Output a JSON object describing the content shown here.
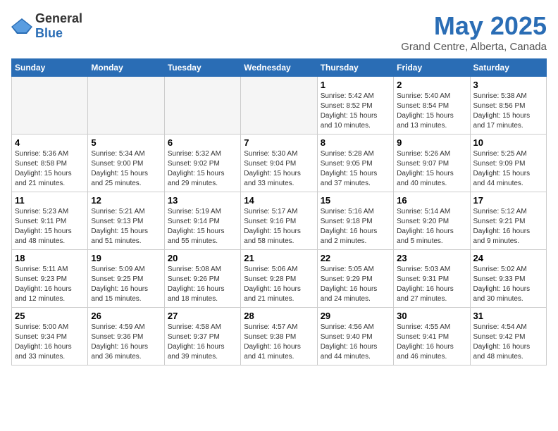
{
  "header": {
    "logo_general": "General",
    "logo_blue": "Blue",
    "title": "May 2025",
    "subtitle": "Grand Centre, Alberta, Canada"
  },
  "days_of_week": [
    "Sunday",
    "Monday",
    "Tuesday",
    "Wednesday",
    "Thursday",
    "Friday",
    "Saturday"
  ],
  "weeks": [
    [
      {
        "num": "",
        "info": ""
      },
      {
        "num": "",
        "info": ""
      },
      {
        "num": "",
        "info": ""
      },
      {
        "num": "",
        "info": ""
      },
      {
        "num": "1",
        "info": "Sunrise: 5:42 AM\nSunset: 8:52 PM\nDaylight: 15 hours\nand 10 minutes."
      },
      {
        "num": "2",
        "info": "Sunrise: 5:40 AM\nSunset: 8:54 PM\nDaylight: 15 hours\nand 13 minutes."
      },
      {
        "num": "3",
        "info": "Sunrise: 5:38 AM\nSunset: 8:56 PM\nDaylight: 15 hours\nand 17 minutes."
      }
    ],
    [
      {
        "num": "4",
        "info": "Sunrise: 5:36 AM\nSunset: 8:58 PM\nDaylight: 15 hours\nand 21 minutes."
      },
      {
        "num": "5",
        "info": "Sunrise: 5:34 AM\nSunset: 9:00 PM\nDaylight: 15 hours\nand 25 minutes."
      },
      {
        "num": "6",
        "info": "Sunrise: 5:32 AM\nSunset: 9:02 PM\nDaylight: 15 hours\nand 29 minutes."
      },
      {
        "num": "7",
        "info": "Sunrise: 5:30 AM\nSunset: 9:04 PM\nDaylight: 15 hours\nand 33 minutes."
      },
      {
        "num": "8",
        "info": "Sunrise: 5:28 AM\nSunset: 9:05 PM\nDaylight: 15 hours\nand 37 minutes."
      },
      {
        "num": "9",
        "info": "Sunrise: 5:26 AM\nSunset: 9:07 PM\nDaylight: 15 hours\nand 40 minutes."
      },
      {
        "num": "10",
        "info": "Sunrise: 5:25 AM\nSunset: 9:09 PM\nDaylight: 15 hours\nand 44 minutes."
      }
    ],
    [
      {
        "num": "11",
        "info": "Sunrise: 5:23 AM\nSunset: 9:11 PM\nDaylight: 15 hours\nand 48 minutes."
      },
      {
        "num": "12",
        "info": "Sunrise: 5:21 AM\nSunset: 9:13 PM\nDaylight: 15 hours\nand 51 minutes."
      },
      {
        "num": "13",
        "info": "Sunrise: 5:19 AM\nSunset: 9:14 PM\nDaylight: 15 hours\nand 55 minutes."
      },
      {
        "num": "14",
        "info": "Sunrise: 5:17 AM\nSunset: 9:16 PM\nDaylight: 15 hours\nand 58 minutes."
      },
      {
        "num": "15",
        "info": "Sunrise: 5:16 AM\nSunset: 9:18 PM\nDaylight: 16 hours\nand 2 minutes."
      },
      {
        "num": "16",
        "info": "Sunrise: 5:14 AM\nSunset: 9:20 PM\nDaylight: 16 hours\nand 5 minutes."
      },
      {
        "num": "17",
        "info": "Sunrise: 5:12 AM\nSunset: 9:21 PM\nDaylight: 16 hours\nand 9 minutes."
      }
    ],
    [
      {
        "num": "18",
        "info": "Sunrise: 5:11 AM\nSunset: 9:23 PM\nDaylight: 16 hours\nand 12 minutes."
      },
      {
        "num": "19",
        "info": "Sunrise: 5:09 AM\nSunset: 9:25 PM\nDaylight: 16 hours\nand 15 minutes."
      },
      {
        "num": "20",
        "info": "Sunrise: 5:08 AM\nSunset: 9:26 PM\nDaylight: 16 hours\nand 18 minutes."
      },
      {
        "num": "21",
        "info": "Sunrise: 5:06 AM\nSunset: 9:28 PM\nDaylight: 16 hours\nand 21 minutes."
      },
      {
        "num": "22",
        "info": "Sunrise: 5:05 AM\nSunset: 9:29 PM\nDaylight: 16 hours\nand 24 minutes."
      },
      {
        "num": "23",
        "info": "Sunrise: 5:03 AM\nSunset: 9:31 PM\nDaylight: 16 hours\nand 27 minutes."
      },
      {
        "num": "24",
        "info": "Sunrise: 5:02 AM\nSunset: 9:33 PM\nDaylight: 16 hours\nand 30 minutes."
      }
    ],
    [
      {
        "num": "25",
        "info": "Sunrise: 5:00 AM\nSunset: 9:34 PM\nDaylight: 16 hours\nand 33 minutes."
      },
      {
        "num": "26",
        "info": "Sunrise: 4:59 AM\nSunset: 9:36 PM\nDaylight: 16 hours\nand 36 minutes."
      },
      {
        "num": "27",
        "info": "Sunrise: 4:58 AM\nSunset: 9:37 PM\nDaylight: 16 hours\nand 39 minutes."
      },
      {
        "num": "28",
        "info": "Sunrise: 4:57 AM\nSunset: 9:38 PM\nDaylight: 16 hours\nand 41 minutes."
      },
      {
        "num": "29",
        "info": "Sunrise: 4:56 AM\nSunset: 9:40 PM\nDaylight: 16 hours\nand 44 minutes."
      },
      {
        "num": "30",
        "info": "Sunrise: 4:55 AM\nSunset: 9:41 PM\nDaylight: 16 hours\nand 46 minutes."
      },
      {
        "num": "31",
        "info": "Sunrise: 4:54 AM\nSunset: 9:42 PM\nDaylight: 16 hours\nand 48 minutes."
      }
    ]
  ]
}
